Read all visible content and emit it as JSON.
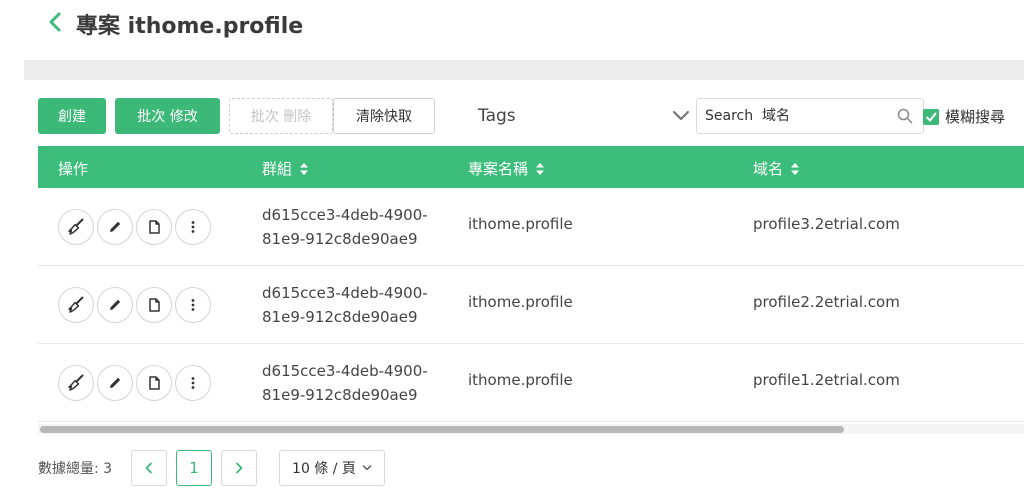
{
  "header": {
    "title": "專案 ithome.profile"
  },
  "toolbar": {
    "create_label": "創建",
    "batch_edit_label": "批次 修改",
    "batch_delete_label": "批次 刪除",
    "clear_cache_label": "清除快取",
    "tags_label": "Tags",
    "search_placeholder": "Search  域名",
    "fuzzy_search_label": "模糊搜尋",
    "fuzzy_search_checked": true
  },
  "table": {
    "columns": [
      "操作",
      "群組",
      "專案名稱",
      "域名"
    ],
    "rows": [
      {
        "group_line1": "d615cce3-4deb-4900-",
        "group_line2": "81e9-912c8de90ae9",
        "project": "ithome.profile",
        "domain": "profile3.2etrial.com"
      },
      {
        "group_line1": "d615cce3-4deb-4900-",
        "group_line2": "81e9-912c8de90ae9",
        "project": "ithome.profile",
        "domain": "profile2.2etrial.com"
      },
      {
        "group_line1": "d615cce3-4deb-4900-",
        "group_line2": "81e9-912c8de90ae9",
        "project": "ithome.profile",
        "domain": "profile1.2etrial.com"
      }
    ],
    "row_action_icons": [
      "broom-icon",
      "pencil-icon",
      "copy-icon",
      "more-vertical-icon"
    ]
  },
  "pagination": {
    "total_label": "數據總量: 3",
    "current_page": "1",
    "page_size_label": "10 條 / 頁"
  },
  "colors": {
    "accent": "#3cb878",
    "header_bg": "#3dbd7b"
  }
}
